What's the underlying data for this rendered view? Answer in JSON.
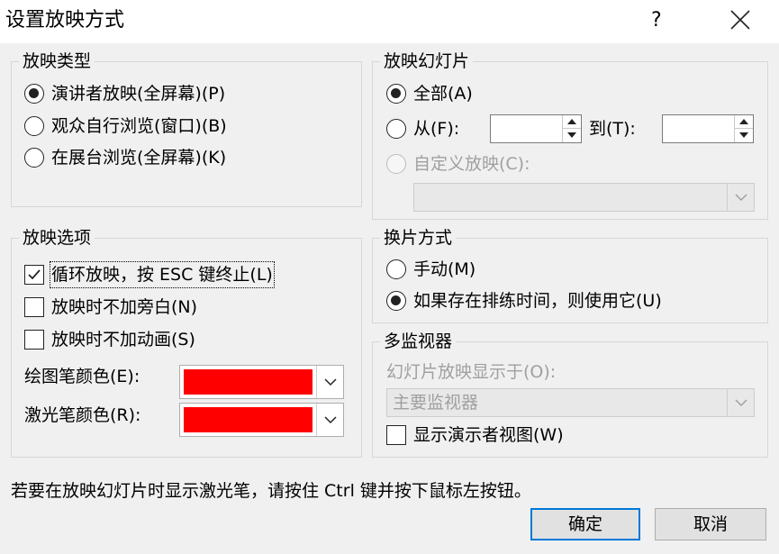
{
  "window": {
    "title": "设置放映方式",
    "help_label": "?"
  },
  "show_type": {
    "legend": "放映类型",
    "options": [
      {
        "label": "演讲者放映(全屏幕)(P)",
        "selected": true
      },
      {
        "label": "观众自行浏览(窗口)(B)",
        "selected": false
      },
      {
        "label": "在展台浏览(全屏幕)(K)",
        "selected": false
      }
    ]
  },
  "show_slides": {
    "legend": "放映幻灯片",
    "all_label": "全部(A)",
    "from_label": "从(F):",
    "from_value": "",
    "to_label": "到(T):",
    "to_value": "",
    "custom_label": "自定义放映(C):",
    "custom_value": "",
    "selected": "all"
  },
  "show_options": {
    "legend": "放映选项",
    "checks": [
      {
        "label": "循环放映，按 ESC 键终止(L)",
        "checked": true
      },
      {
        "label": "放映时不加旁白(N)",
        "checked": false
      },
      {
        "label": "放映时不加动画(S)",
        "checked": false
      }
    ],
    "pen_color_label": "绘图笔颜色(E):",
    "laser_color_label": "激光笔颜色(R):",
    "pen_color": "#ff0000",
    "laser_color": "#ff0000"
  },
  "advance": {
    "legend": "换片方式",
    "options": [
      {
        "label": "手动(M)",
        "selected": false
      },
      {
        "label": "如果存在排练时间，则使用它(U)",
        "selected": true
      }
    ]
  },
  "monitors": {
    "legend": "多监视器",
    "display_on_label": "幻灯片放映显示于(O):",
    "display_on_value": "主要监视器",
    "presenter_view_label": "显示演示者视图(W)",
    "presenter_view_checked": false
  },
  "note": "若要在放映幻灯片时显示激光笔，请按住 Ctrl 键并按下鼠标左按钮。",
  "buttons": {
    "ok": "确定",
    "cancel": "取消"
  },
  "colors": {
    "accent": "#0078d7",
    "background": "#f0f0f0",
    "border": "#d6d6d6"
  }
}
